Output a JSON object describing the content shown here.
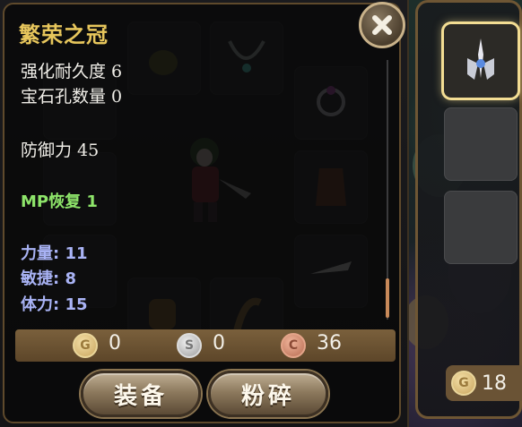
{
  "item": {
    "name": "繁荣之冠",
    "enhance_label": "强化耐久度 6",
    "gem_label": "宝石孔数量 0",
    "defense_label": "防御力 45",
    "mp_label": "MP恢复 1",
    "str_label": "力量: 11",
    "agi_label": "敏捷: 8",
    "vit_label": "体力: 15"
  },
  "price": {
    "gold_icon": "G",
    "gold": "0",
    "silver_icon": "S",
    "silver": "0",
    "copper_icon": "C",
    "copper": "36"
  },
  "buttons": {
    "equip": "装备",
    "smash": "粉碎"
  },
  "currency": {
    "gold_icon": "G",
    "gold_amount": "18"
  },
  "colors": {
    "title": "#e7c65c",
    "mp_stat": "#8ee56a",
    "attribute_stat": "#a9b3f5",
    "selected_slot_glow": "#f3dd93"
  },
  "icons": {
    "close": "close-icon",
    "selected_item": "crown-icon"
  }
}
